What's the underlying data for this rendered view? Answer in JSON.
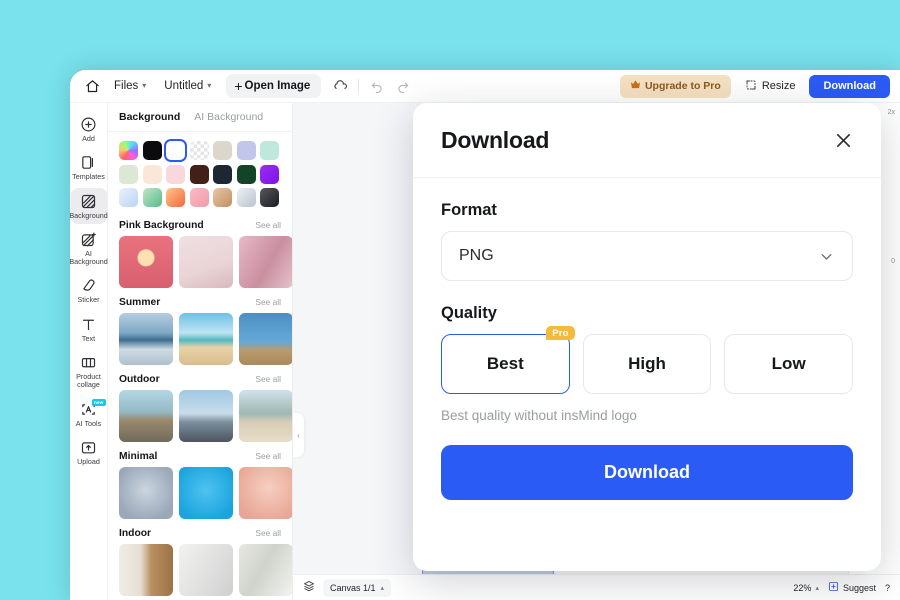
{
  "topbar": {
    "home_icon": "home-icon",
    "files_label": "Files",
    "doc_title": "Untitled",
    "open_image_label": "Open Image",
    "cloud_icon": "cloud-sync-icon",
    "undo_icon": "undo-icon",
    "redo_icon": "redo-icon",
    "upgrade_label": "Upgrade to Pro",
    "crown_icon": "crown-icon",
    "resize_label": "Resize",
    "resize_icon": "resize-icon",
    "download_label": "Download"
  },
  "rail": {
    "items": [
      {
        "label": "Add",
        "icon": "plus-circle-icon",
        "active": false,
        "badge": ""
      },
      {
        "label": "Templates",
        "icon": "templates-icon",
        "active": false,
        "badge": ""
      },
      {
        "label": "Background",
        "icon": "background-icon",
        "active": true,
        "badge": ""
      },
      {
        "label": "AI\nBackground",
        "icon": "ai-background-icon",
        "active": false,
        "badge": ""
      },
      {
        "label": "Sticker",
        "icon": "sticker-icon",
        "active": false,
        "badge": ""
      },
      {
        "label": "Text",
        "icon": "text-icon",
        "active": false,
        "badge": ""
      },
      {
        "label": "Product\ncollage",
        "icon": "product-collage-icon",
        "active": false,
        "badge": ""
      },
      {
        "label": "AI Tools",
        "icon": "ai-tools-icon",
        "active": false,
        "badge": "new"
      },
      {
        "label": "Upload",
        "icon": "upload-icon",
        "active": false,
        "badge": ""
      }
    ]
  },
  "panel": {
    "tabs": [
      {
        "label": "Background",
        "active": true
      },
      {
        "label": "AI Background",
        "active": false
      }
    ],
    "see_all_label": "See all",
    "swatches": [
      {
        "name": "rainbow",
        "css": "conic-gradient(from 210deg,#ff5f6d,#ffc371,#9bff6d,#59d7ff,#9a6dff,#ff5fd1,#ff5f6d)"
      },
      {
        "name": "black",
        "css": "#0b0b0d"
      },
      {
        "name": "white",
        "css": "#ffffff",
        "selected": true
      },
      {
        "name": "transparent",
        "css": "repeating-conic-gradient(#ffffff 0% 25%, #e4e4e6 0% 50%) 0 0/7px 7px"
      },
      {
        "name": "beige",
        "css": "#ddd7cb"
      },
      {
        "name": "periwinkle",
        "css": "#c3c6ec"
      },
      {
        "name": "mint",
        "css": "#bfe8dc"
      },
      {
        "name": "pale-green",
        "css": "#dde8d4"
      },
      {
        "name": "cream",
        "css": "#fbe6d8"
      },
      {
        "name": "pink",
        "css": "#f9d8dc"
      },
      {
        "name": "brown",
        "css": "#422018"
      },
      {
        "name": "navy",
        "css": "#1d2633"
      },
      {
        "name": "forest",
        "css": "#144427"
      },
      {
        "name": "purple",
        "css": "linear-gradient(135deg,#9b2df2,#7d12e8)"
      },
      {
        "name": "blue-gradient",
        "css": "linear-gradient(135deg,#eaf2fb,#b9d4f2)"
      },
      {
        "name": "green-gradient",
        "css": "linear-gradient(135deg,#bfe6c6,#59b98d)"
      },
      {
        "name": "orange-gradient",
        "css": "linear-gradient(135deg,#ffc88a,#f5663c)"
      },
      {
        "name": "pink-gradient",
        "css": "linear-gradient(135deg,#f5bcc8,#f39aa6)"
      },
      {
        "name": "tan-gradient",
        "css": "linear-gradient(135deg,#e8c7a6,#c08f63)"
      },
      {
        "name": "silver-gradient",
        "css": "linear-gradient(135deg,#eef1f4,#b9c2cc)"
      },
      {
        "name": "charcoal-gradient",
        "css": "linear-gradient(135deg,#56585c,#1b1c20)"
      }
    ],
    "sections": [
      {
        "title": "Pink Background",
        "thumbs": [
          "radial-gradient(circle at 50% 42%, rgba(255,230,180,.95) 0 8px, transparent 9px), linear-gradient(180deg,#e8737e,#d95f6e)",
          "linear-gradient(160deg,#efe0e2,#e9d4d6 60%,#d8b9bd)",
          "linear-gradient(120deg,#e8b8c6,#c98f9f 55%,#e6c3cc)"
        ]
      },
      {
        "title": "Summer",
        "thumbs": [
          "linear-gradient(180deg,#b5cde0 0%,#7fa9c6 38%,#3f6e90 52%,#cfdbe4 70%,#aebfcd 100%)",
          "linear-gradient(180deg,#6ec0e8 0%,#bfe4f2 38%,#53b8c0 52%,#e8d3a8 66%,#d8bd8e 100%)",
          "linear-gradient(180deg,#4d8fc4 0%,#64a9d6 55%,#b99a6c 72%,#a88a5e 100%)"
        ]
      },
      {
        "title": "Outdoor",
        "thumbs": [
          "linear-gradient(180deg,#b4d7e4 0%,#93b9c5 42%,#9a8a6e 58%,#6f6a5a 100%)",
          "linear-gradient(180deg,#9fc9e4 0%,#c9dcea 45%,#7c8e9c 62%,#4c5560 100%)",
          "linear-gradient(180deg,#cfe2ec 0%,#9fb8b2 45%,#d8cdb6 62%,#e6ddc8 100%)"
        ]
      },
      {
        "title": "Minimal",
        "thumbs": [
          "radial-gradient(circle at 50% 45%, #ccd6e0 0%, #9aa8b8 75%)",
          "radial-gradient(circle at 50% 45%, #4fc3f0 0%, #1aa3dd 80%)",
          "radial-gradient(circle at 55% 40%, #f6cfc0 0%, #e8a594 80%)"
        ]
      },
      {
        "title": "Indoor",
        "thumbs": [
          "linear-gradient(90deg,#f0ece6 0%,#e5dfd5 40%,#b98f5f 60%,#9a7346 100%)",
          "linear-gradient(120deg,#f2f2f0,#dedede 60%,#cfcfce)",
          "linear-gradient(120deg,#e9e7e3,#cfd3cb 45%,#f4f3f1)"
        ]
      }
    ]
  },
  "canvas": {
    "collapse_icon": "chevron-left-icon",
    "artboard_name": "product-artboard"
  },
  "statusbar": {
    "layers_icon": "layers-icon",
    "canvas_label": "Canvas 1/1",
    "canvas_caret_icon": "chevron-up-icon",
    "zoom_label": "22%",
    "zoom_caret_icon": "chevron-up-icon",
    "suggest_icon": "suggest-icon",
    "suggest_label": "Suggest",
    "help_label": "?"
  },
  "right_panel": {
    "zoom_mark": "2x",
    "value_mark": "0"
  },
  "modal": {
    "title": "Download",
    "close_icon": "close-icon",
    "format_label": "Format",
    "format_value": "PNG",
    "format_caret_icon": "chevron-down-icon",
    "quality_label": "Quality",
    "quality_options": [
      {
        "label": "Best",
        "selected": true,
        "badge": "Pro"
      },
      {
        "label": "High",
        "selected": false,
        "badge": ""
      },
      {
        "label": "Low",
        "selected": false,
        "badge": ""
      }
    ],
    "quality_hint": "Best quality without insMind logo",
    "download_label": "Download"
  },
  "colors": {
    "page_background": "#79e2ec",
    "accent_blue": "#2b5bf5",
    "pro_amber": "#f5b93c",
    "upgrade_bg": "#f6e0c2",
    "new_badge": "#19c8e0"
  }
}
